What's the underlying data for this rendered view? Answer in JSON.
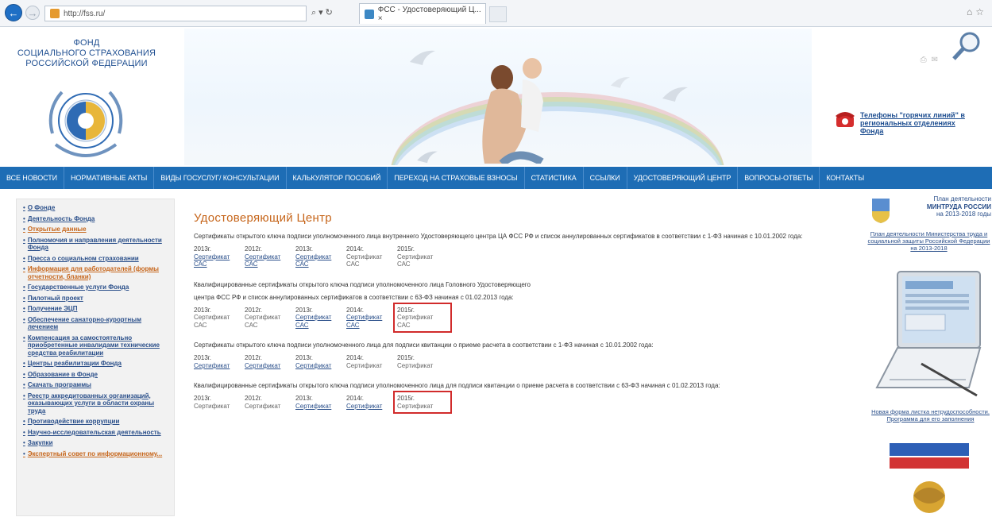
{
  "browser": {
    "url": "http://fss.ru/",
    "tab_title": "ФСС - Удостоверяющий Ц... ×"
  },
  "header": {
    "logo_line1": "ФОНД",
    "logo_line2": "СОЦИАЛЬНОГО СТРАХОВАНИЯ",
    "logo_line3": "РОССИЙСКОЙ ФЕДЕРАЦИИ",
    "hotline_link": "Телефоны \"горячих линий\" в региональных отделениях Фонда"
  },
  "nav": {
    "items": [
      "ВСЕ НОВОСТИ",
      "НОРМАТИВНЫЕ АКТЫ",
      "ВИДЫ ГОСУСЛУГ/ КОНСУЛЬТАЦИИ",
      "КАЛЬКУЛЯТОР ПОСОБИЙ",
      "ПЕРЕХОД НА СТРАХОВЫЕ ВЗНОСЫ",
      "СТАТИСТИКА",
      "ССЫЛКИ",
      "УДОСТОВЕРЯЮЩИЙ ЦЕНТР",
      "ВОПРОСЫ-ОТВЕТЫ",
      "КОНТАКТЫ"
    ]
  },
  "sidebar": {
    "items": [
      {
        "label": "О Фонде",
        "accent": false
      },
      {
        "label": "Деятельность Фонда",
        "accent": false
      },
      {
        "label": "Открытые данные",
        "accent": true
      },
      {
        "label": "Полномочия и направления деятельности Фонда",
        "accent": false
      },
      {
        "label": "Пресса о социальном страховании",
        "accent": false
      },
      {
        "label": "Информация для работодателей (формы отчетности, бланки)",
        "accent": true
      },
      {
        "label": "Государственные услуги Фонда",
        "accent": false
      },
      {
        "label": "Пилотный проект",
        "accent": false
      },
      {
        "label": "Получение ЭЦП",
        "accent": false
      },
      {
        "label": "Обеспечение санаторно-курортным лечением",
        "accent": false
      },
      {
        "label": "Компенсация за самостоятельно приобретенные инвалидами технические средства реабилитации",
        "accent": false
      },
      {
        "label": "Центры реабилитации Фонда",
        "accent": false
      },
      {
        "label": "Образование в Фонде",
        "accent": false
      },
      {
        "label": "Скачать программы",
        "accent": false
      },
      {
        "label": "Реестр аккредитованных организаций, оказывающих услуги в области охраны труда",
        "accent": false
      },
      {
        "label": "Противодействие коррупции",
        "accent": false
      },
      {
        "label": "Научно-исследовательская деятельность",
        "accent": false
      },
      {
        "label": "Закупки",
        "accent": false
      },
      {
        "label": "Экспертный совет по информационному...",
        "accent": true
      }
    ]
  },
  "main": {
    "title": "Удостоверяющий Центр",
    "sections": [
      {
        "text": "Сертификаты открытого ключа подписи уполномоченного лица внутреннего Удостоверяющего центра ЦА ФСС РФ и список аннулированных сертификатов в соответствии с 1-ФЗ начиная с 10.01.2002 года:",
        "years": [
          {
            "year": "2013г.",
            "line1": "Сертификат",
            "line2": "САС",
            "link": true
          },
          {
            "year": "2012г.",
            "line1": "Сертификат",
            "line2": "САС",
            "link": true
          },
          {
            "year": "2013г.",
            "line1": "Сертификат",
            "line2": "САС",
            "link": true
          },
          {
            "year": "2014г.",
            "line1": "Сертификат",
            "line2": "САС",
            "link": false
          },
          {
            "year": "2015г.",
            "line1": "Сертификат",
            "line2": "САС",
            "link": false
          }
        ],
        "highlight_index": -1
      },
      {
        "text": "Квалифицированные сертификаты открытого ключа подписи уполномоченного лица Головного Удостоверяющего",
        "text2": "центра ФСС РФ и список аннулированных сертификатов в соответствии с 63-ФЗ начиная с 01.02.2013 года:",
        "years": [
          {
            "year": "2013г.",
            "line1": "Сертификат",
            "line2": "САС",
            "link": false
          },
          {
            "year": "2012г.",
            "line1": "Сертификат",
            "line2": "САС",
            "link": false
          },
          {
            "year": "2013г.",
            "line1": "Сертификат",
            "line2": "САС",
            "link": true
          },
          {
            "year": "2014г.",
            "line1": "Сертификат",
            "line2": "САС",
            "link": true
          },
          {
            "year": "2015г.",
            "line1": "Сертификат",
            "line2": "САС",
            "link": false
          }
        ],
        "highlight_index": 4
      },
      {
        "text": "Сертификаты открытого ключа подписи уполномоченного лица для подписи квитанции о приеме расчета в соответствии с 1-ФЗ начиная с 10.01.2002 года:",
        "years": [
          {
            "year": "2013г.",
            "line1": "Сертификат",
            "line2": "",
            "link": true
          },
          {
            "year": "2012г.",
            "line1": "Сертификат",
            "line2": "",
            "link": true
          },
          {
            "year": "2013г.",
            "line1": "Сертификат",
            "line2": "",
            "link": true
          },
          {
            "year": "2014г.",
            "line1": "Сертификат",
            "line2": "",
            "link": false
          },
          {
            "year": "2015г.",
            "line1": "Сертификат",
            "line2": "",
            "link": false
          }
        ],
        "highlight_index": -1
      },
      {
        "text": "Квалифицированные сертификаты открытого ключа подписи уполномоченного лица для подписи квитанции о приеме расчета в соответствии с 63-ФЗ начиная с 01.02.2013 года:",
        "years": [
          {
            "year": "2013г.",
            "line1": "Сертификат",
            "line2": "",
            "link": false
          },
          {
            "year": "2012г.",
            "line1": "Сертификат",
            "line2": "",
            "link": false
          },
          {
            "year": "2013г.",
            "line1": "Сертификат",
            "line2": "",
            "link": true
          },
          {
            "year": "2014г.",
            "line1": "Сертификат",
            "line2": "",
            "link": true
          },
          {
            "year": "2015г.",
            "line1": "Сертификат",
            "line2": "",
            "link": false
          }
        ],
        "highlight_index": 4
      }
    ]
  },
  "right": {
    "mintrud_line1": "План деятельности",
    "mintrud_line2": "МИНТРУДА РОССИИ",
    "mintrud_line3": "на 2013-2018 годы",
    "plan_link": "План деятельности Министерства труда и социальной защиты Российской Федерации на 2013-2018",
    "newform_link": "Новая форма листка нетрудоспособности. Программа для его заполнения"
  },
  "colors": {
    "nav_bg": "#1e6db5",
    "accent_orange": "#c6651a",
    "link_blue": "#2a4f8a",
    "highlight_red": "#d12b2b"
  }
}
